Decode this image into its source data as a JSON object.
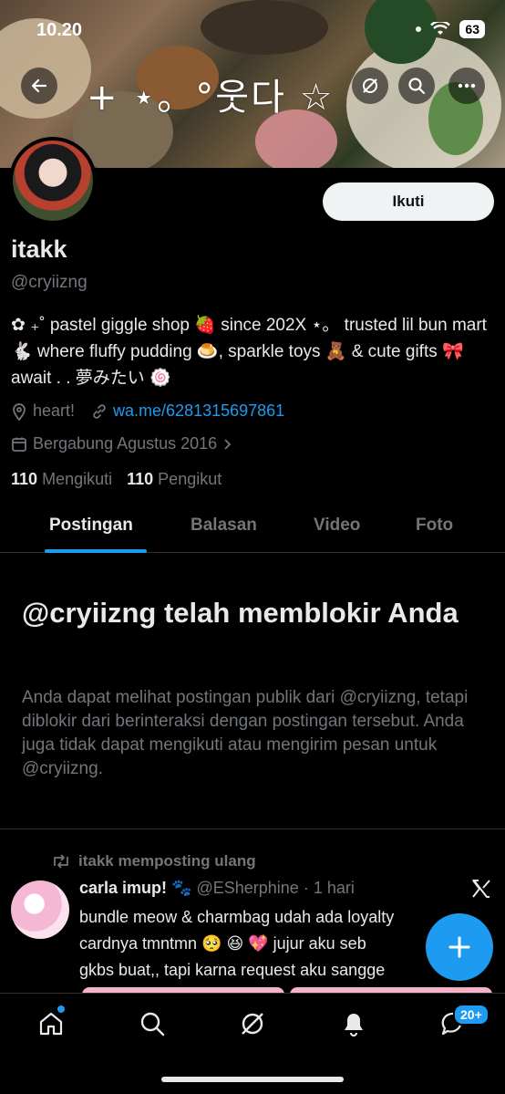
{
  "status_bar": {
    "time": "10.20",
    "battery": "63"
  },
  "banner": {
    "title": "+ ⋆。°웃다 ☆"
  },
  "profile": {
    "name": "itakk",
    "handle": "@cryiizng",
    "follow_label": "Ikuti",
    "bio": "✿ ₊˚ pastel giggle shop 🍓 since 202X ⋆。 trusted lil bun mart 🐇 where fluffy pudding 🍮, sparkle toys 🧸 & cute gifts 🎀 await . . 夢みたい 🍥",
    "location": "heart!",
    "link": "wa.me/6281315697861",
    "joined": "Bergabung Agustus 2016",
    "following_count": "110",
    "following_label": "Mengikuti",
    "followers_count": "110",
    "followers_label": "Pengikut"
  },
  "tabs": [
    "Postingan",
    "Balasan",
    "Video",
    "Foto"
  ],
  "blocked": {
    "title": "@cryiizng telah memblokir Anda",
    "description": "Anda dapat melihat postingan publik dari @cryiizng, tetapi diblokir dari berinteraksi dengan postingan tersebut. Anda juga tidak dapat mengikuti atau mengirim pesan untuk @cryiizng."
  },
  "post": {
    "repost_label": "itakk memposting ulang",
    "author_name": "carla imup! 🐾",
    "author_handle": "@ESherphine",
    "time": "· 1 hari",
    "lines": [
      "bundle meow & charmbag udah ada loyalty",
      "cardnya tmntmn 🥺 😆 💖 jujur aku seb",
      "gkbs buat,, tapi karna request aku sangge"
    ]
  },
  "nav": {
    "badge": "20+"
  },
  "colors": {
    "accent": "#1d9bf0",
    "background": "#000000",
    "muted": "#71767b",
    "text": "#e7e9ea"
  }
}
